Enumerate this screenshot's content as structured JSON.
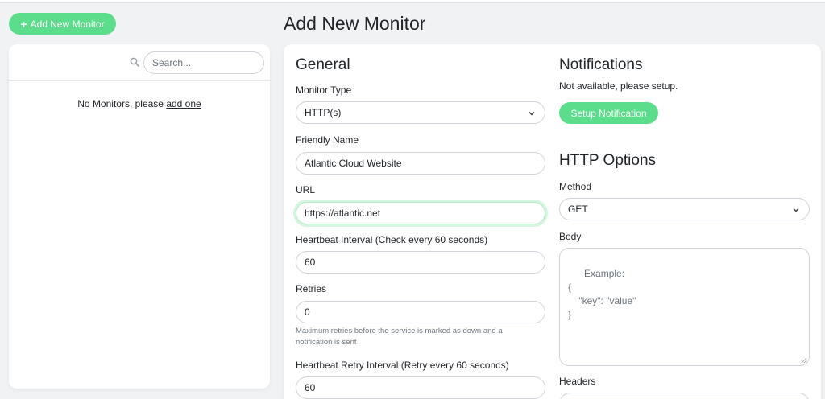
{
  "sidebar": {
    "add_button_label": "Add New Monitor",
    "search_placeholder": "Search...",
    "empty_text": "No Monitors, please ",
    "empty_link": "add one"
  },
  "page": {
    "title": "Add New Monitor"
  },
  "general": {
    "title": "General",
    "monitor_type_label": "Monitor Type",
    "monitor_type_value": "HTTP(s)",
    "friendly_name_label": "Friendly Name",
    "friendly_name_value": "Atlantic Cloud Website",
    "url_label": "URL",
    "url_value": "https://atlantic.net",
    "heartbeat_label": "Heartbeat Interval (Check every 60 seconds)",
    "heartbeat_value": "60",
    "retries_label": "Retries",
    "retries_value": "0",
    "retries_help": "Maximum retries before the service is marked as down and a notification is sent",
    "retry_interval_label": "Heartbeat Retry Interval (Retry every 60 seconds)",
    "retry_interval_value": "60"
  },
  "notifications": {
    "title": "Notifications",
    "status_text": "Not available, please setup.",
    "setup_button_label": "Setup Notification"
  },
  "http_options": {
    "title": "HTTP Options",
    "method_label": "Method",
    "method_value": "GET",
    "body_label": "Body",
    "body_placeholder": "Example:\n{\n    \"key\": \"value\"\n}",
    "headers_label": "Headers"
  },
  "colors": {
    "accent": "#5cdd8b",
    "background": "#f0f2f4",
    "card": "#ffffff"
  },
  "icons": [
    "plus-icon",
    "search-icon",
    "chevron-down-icon",
    "resize-handle-icon"
  ]
}
